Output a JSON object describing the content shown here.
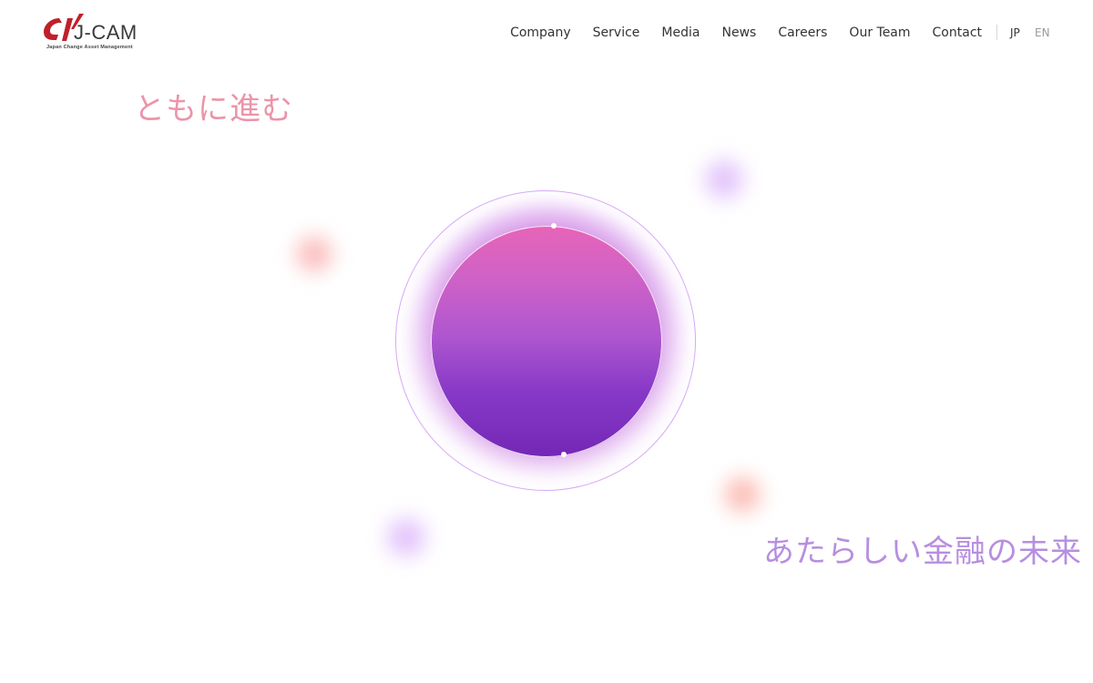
{
  "brand": {
    "name": "J-CAM",
    "tagline": "Japan Change Asset Management",
    "logo_icon": "jcam-swoosh-logo",
    "colors": {
      "logo_red": "#c0202a",
      "text": "#333333"
    }
  },
  "nav": {
    "items": [
      "Company",
      "Service",
      "Media",
      "News",
      "Careers",
      "Our Team",
      "Contact"
    ]
  },
  "language": {
    "jp": "JP",
    "en": "EN",
    "active": "JP"
  },
  "hero": {
    "headline_top": "ともに進む",
    "headline_bottom": "あたらしい金融の未来",
    "colors": {
      "headline_top": "#ec8fa6",
      "headline_bottom": "#b78ee0",
      "orb_top": "#e764b8",
      "orb_bottom": "#7427b5"
    }
  }
}
